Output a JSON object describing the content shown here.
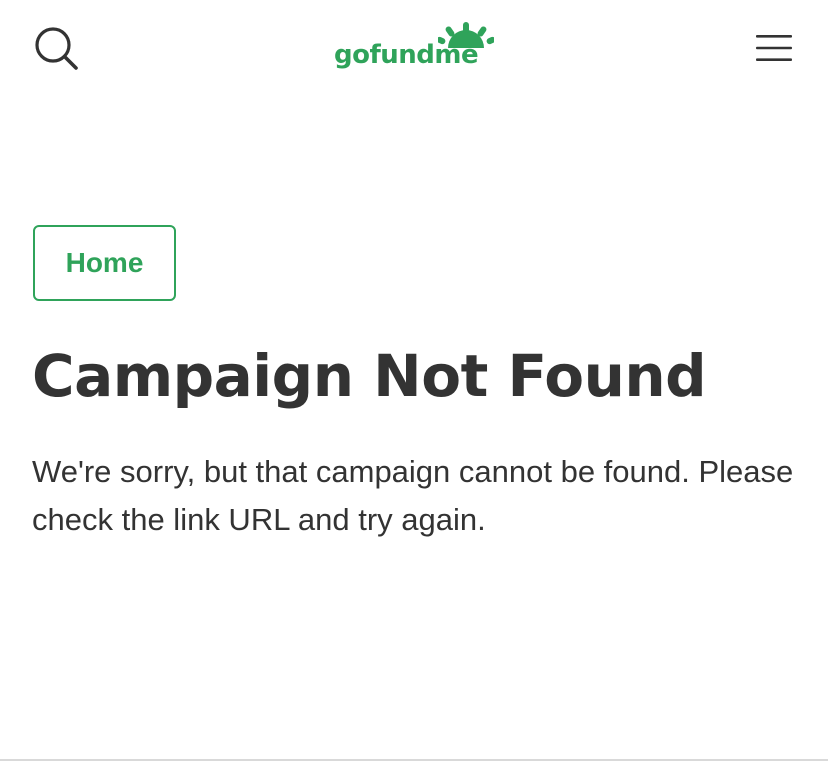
{
  "header": {
    "search_icon": "search-icon",
    "menu_icon": "hamburger-menu-icon",
    "logo": {
      "text": "gofundme",
      "color": "#2fa35a"
    }
  },
  "nav": {
    "home_label": "Home"
  },
  "main": {
    "title": "Campaign Not Found",
    "message": "We're sorry, but that campaign cannot be found. Please check the link URL and try again."
  },
  "colors": {
    "brand": "#2fa35a",
    "text": "#333333",
    "background": "#ffffff"
  }
}
